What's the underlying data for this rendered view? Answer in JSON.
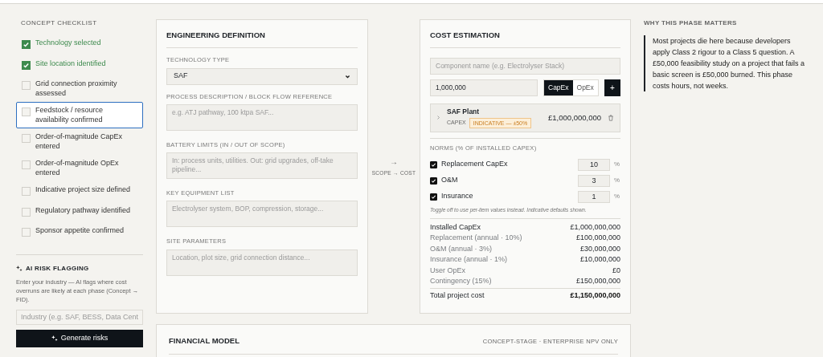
{
  "checklist": {
    "title": "CONCEPT CHECKLIST",
    "items": [
      {
        "label": "Technology selected",
        "checked": true,
        "focused": false
      },
      {
        "label": "Site location identified",
        "checked": true,
        "focused": false
      },
      {
        "label": "Grid connection proximity assessed",
        "checked": false,
        "focused": false
      },
      {
        "label": "Feedstock / resource availability confirmed",
        "checked": false,
        "focused": true
      },
      {
        "label": "Order-of-magnitude CapEx entered",
        "checked": false,
        "focused": false
      },
      {
        "label": "Order-of-magnitude OpEx entered",
        "checked": false,
        "focused": false
      },
      {
        "label": "Indicative project size defined",
        "checked": false,
        "focused": false
      },
      {
        "label": "Regulatory pathway identified",
        "checked": false,
        "focused": false
      },
      {
        "label": "Sponsor appetite confirmed",
        "checked": false,
        "focused": false
      }
    ]
  },
  "ai_risk": {
    "title": "AI RISK FLAGGING",
    "description": "Enter your industry — AI flags where cost overruns are likely at each phase (Concept → FID).",
    "placeholder": "Industry (e.g. SAF, BESS, Data Cent",
    "button": "Generate risks"
  },
  "engineering": {
    "title": "ENGINEERING DEFINITION",
    "technology_label": "TECHNOLOGY TYPE",
    "technology_value": "SAF",
    "fields": [
      {
        "label": "PROCESS DESCRIPTION / BLOCK FLOW REFERENCE",
        "placeholder": "e.g. ATJ pathway, 100 ktpa SAF..."
      },
      {
        "label": "BATTERY LIMITS (IN / OUT OF SCOPE)",
        "placeholder": "In: process units, utilities. Out: grid upgrades, off-take pipeline..."
      },
      {
        "label": "KEY EQUIPMENT LIST",
        "placeholder": "Electrolyser system, BOP, compression, storage..."
      },
      {
        "label": "SITE PARAMETERS",
        "placeholder": "Location, plot size, grid connection distance..."
      }
    ]
  },
  "connector": {
    "arrow": "→",
    "label": "SCOPE → COST"
  },
  "cost": {
    "title": "COST ESTIMATION",
    "component_placeholder": "Component name (e.g. Electrolyser Stack)",
    "amount": "1,000,000",
    "types": [
      {
        "label": "CapEx",
        "selected": true
      },
      {
        "label": "OpEx",
        "selected": false
      }
    ],
    "add": "+",
    "items": [
      {
        "name": "SAF Plant",
        "type": "CAPEX",
        "badge": "INDICATIVE — ±50%",
        "amount": "£1,000,000,000"
      }
    ],
    "norms_title": "NORMS (% OF INSTALLED CAPEX)",
    "norms": [
      {
        "label": "Replacement CapEx",
        "checked": true,
        "value": "10",
        "unit": "%"
      },
      {
        "label": "O&M",
        "checked": true,
        "value": "3",
        "unit": "%"
      },
      {
        "label": "Insurance",
        "checked": true,
        "value": "1",
        "unit": "%"
      }
    ],
    "note": "Toggle off to use per-item values instead. Indicative defaults shown.",
    "summary": [
      {
        "kind": "base",
        "label": "Installed CapEx",
        "value": "£1,000,000,000"
      },
      {
        "kind": "derived",
        "label": "Replacement (annual · 10%)",
        "value": "£100,000,000"
      },
      {
        "kind": "derived",
        "label": "O&M (annual · 3%)",
        "value": "£30,000,000"
      },
      {
        "kind": "derived",
        "label": "Insurance (annual · 1%)",
        "value": "£10,000,000"
      },
      {
        "kind": "derived",
        "label": "User OpEx",
        "value": "£0"
      },
      {
        "kind": "derived",
        "label": "Contingency (15%)",
        "value": "£150,000,000"
      },
      {
        "kind": "total",
        "label": "Total project cost",
        "value": "£1,150,000,000"
      }
    ]
  },
  "why": {
    "title": "WHY THIS PHASE MATTERS",
    "text": "Most projects die here because developers apply Class 2 rigour to a Class 5 question. A £50,000 feasibility study on a project that fails a basic screen is £50,000 burned. This phase costs hours, not weeks."
  },
  "financial": {
    "title": "FINANCIAL MODEL",
    "subtitle": "CONCEPT-STAGE · ENTERPRISE NPV ONLY"
  }
}
